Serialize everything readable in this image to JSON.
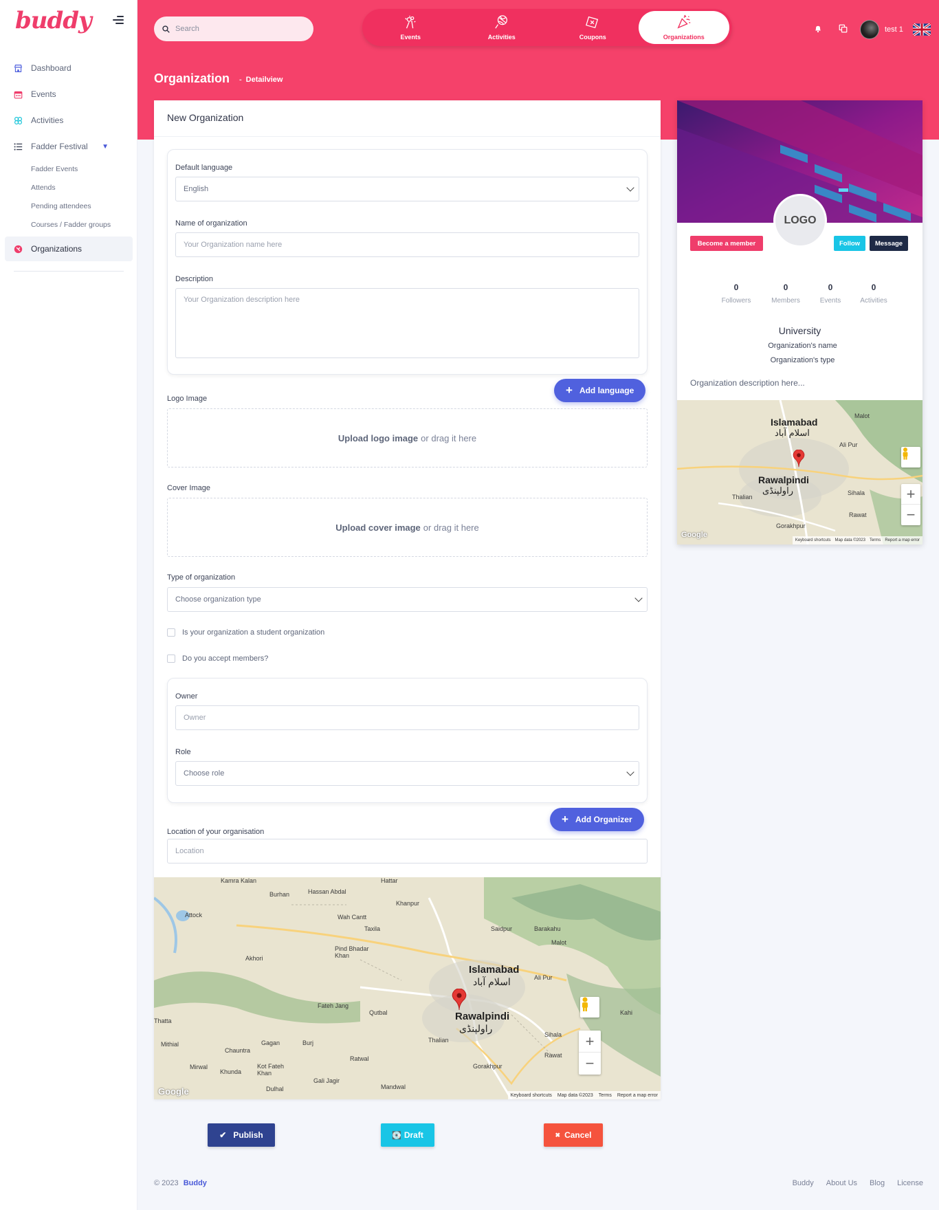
{
  "brand": {
    "logo": "buddy",
    "accent": "#f5416a",
    "primary": "#5061de"
  },
  "sidebar": {
    "items": [
      {
        "label": "Dashboard",
        "icon": "store-icon"
      },
      {
        "label": "Events",
        "icon": "calendar-icon"
      },
      {
        "label": "Activities",
        "icon": "activities-icon"
      },
      {
        "label": "Fadder Festival",
        "icon": "list-icon"
      }
    ],
    "subitems": [
      "Fadder Events",
      "Attends",
      "Pending attendees",
      "Courses / Fadder groups"
    ],
    "active": {
      "label": "Organizations",
      "icon": "organization-icon"
    }
  },
  "header": {
    "search_placeholder": "Search",
    "tabs": [
      {
        "label": "Events",
        "icon": "fireworks-icon"
      },
      {
        "label": "Activities",
        "icon": "ball-icon"
      },
      {
        "label": "Coupons",
        "icon": "coupon-icon"
      },
      {
        "label": "Organizations",
        "icon": "party-icon"
      }
    ],
    "active_tab": "Organizations",
    "user_name": "test 1",
    "page_title": "Organization",
    "breadcrumb": "Detailview"
  },
  "form": {
    "title": "New Organization",
    "default_language_label": "Default language",
    "default_language_value": "English",
    "name_label": "Name of organization",
    "name_placeholder": "Your Organization name here",
    "description_label": "Description",
    "description_placeholder": "Your Organization description here",
    "add_language": "Add language",
    "logo_label": "Logo Image",
    "logo_upload_strong": "Upload logo image",
    "cover_label": "Cover Image",
    "cover_upload_strong": "Upload cover image",
    "drag_text": "or drag it here",
    "type_label": "Type of organization",
    "type_placeholder": "Choose organization type",
    "student_org_label": "Is your organization a student organization",
    "accept_members_label": "Do you accept members?",
    "owner_label": "Owner",
    "owner_placeholder": "Owner",
    "role_label": "Role",
    "role_placeholder": "Choose role",
    "add_organizer": "Add Organizer",
    "location_label": "Location of your organisation",
    "location_placeholder": "Location"
  },
  "map_large": {
    "cities": [
      "Islamabad",
      "اسلام آباد",
      "Rawalpindi",
      "راولپنڈی"
    ],
    "places": [
      "Attock",
      "Hassan Abdal",
      "Burhan",
      "Wah Cantt",
      "Taxila",
      "Khanpur",
      "Saidpur",
      "Barakahu",
      "Malot",
      "Pind Bhadar Khan",
      "Akhori",
      "Ali Pur",
      "Fateh Jang",
      "Qutbal",
      "Thalian",
      "Sihala",
      "Rawat",
      "Gorakhpur",
      "Chauntra",
      "Gagan",
      "Burj",
      "Ratwal",
      "Mithial",
      "Mirwal",
      "Khunda",
      "Kot Fateh Khan",
      "Dulhal",
      "Gali Jagir",
      "Mandwal",
      "Thatta",
      "Hattar",
      "Kamra Kalan",
      "Kahi"
    ],
    "footer": [
      "Keyboard shortcuts",
      "Map data ©2023",
      "Terms",
      "Report a map error"
    ]
  },
  "map_small": {
    "cities": [
      "Islamabad",
      "اسلام آباد",
      "Rawalpindi",
      "راولپنڈی"
    ],
    "places": [
      "Malot",
      "Ali Pur",
      "Thalian",
      "Sihala",
      "Rawat",
      "Gorakhpur"
    ],
    "footer": [
      "Keyboard shortcuts",
      "Map data ©2023",
      "Terms",
      "Report a map error"
    ]
  },
  "actions": {
    "publish": "Publish",
    "draft": "Draft",
    "cancel": "Cancel"
  },
  "profile": {
    "logo": "LOGO",
    "become_member": "Become a member",
    "follow": "Follow",
    "message": "Message",
    "stats": [
      {
        "value": "0",
        "label": "Followers"
      },
      {
        "value": "0",
        "label": "Members"
      },
      {
        "value": "0",
        "label": "Events"
      },
      {
        "value": "0",
        "label": "Activities"
      }
    ],
    "category": "University",
    "org_name": "Organization's name",
    "org_type": "Organization's type",
    "description": "Organization description here..."
  },
  "footer": {
    "copyright": "© 2023",
    "brand": "Buddy",
    "links": [
      "Buddy",
      "About Us",
      "Blog",
      "License"
    ]
  }
}
